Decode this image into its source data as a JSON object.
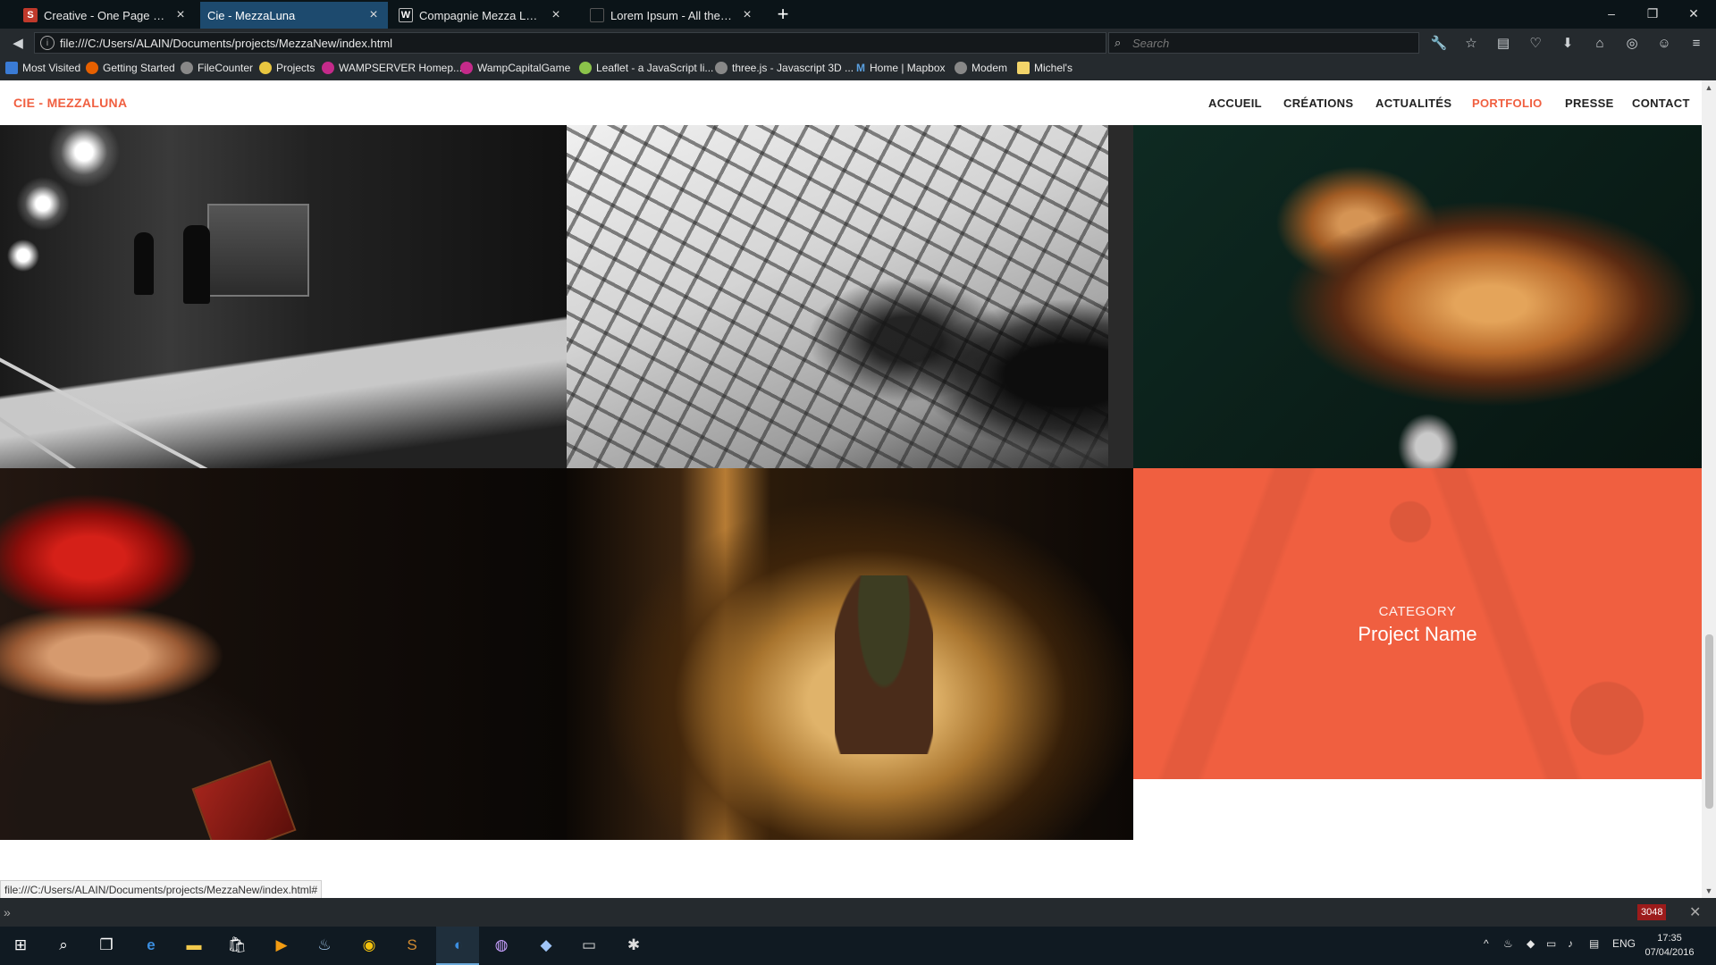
{
  "browser": {
    "tabs": [
      {
        "title": "Creative - One Page Boots...",
        "favicon": "S",
        "active": false
      },
      {
        "title": "Cie - MezzaLuna",
        "favicon": "",
        "active": true
      },
      {
        "title": "Compagnie Mezza Luna",
        "favicon": "W",
        "active": false
      },
      {
        "title": "Lorem Ipsum - All the fact...",
        "favicon": "",
        "active": false
      }
    ],
    "new_tab": "+",
    "url": "file:///C:/Users/ALAIN/Documents/projects/MezzaNew/index.html",
    "search_placeholder": "Search",
    "bookmarks": [
      {
        "label": "Most Visited"
      },
      {
        "label": "Getting Started"
      },
      {
        "label": "FileCounter"
      },
      {
        "label": "Projects"
      },
      {
        "label": "WAMPSERVER Homep..."
      },
      {
        "label": "WampCapitalGame"
      },
      {
        "label": "Leaflet - a JavaScript li..."
      },
      {
        "label": "three.js - Javascript 3D ..."
      },
      {
        "label": "Home | Mapbox"
      },
      {
        "label": "Modem"
      },
      {
        "label": "Michel's"
      }
    ],
    "status_url": "file:///C:/Users/ALAIN/Documents/projects/MezzaNew/index.html#",
    "dev_badge": "3048"
  },
  "site": {
    "brand": "CIE - MEZZALUNA",
    "menu": [
      "ACCUEIL",
      "CRÉATIONS",
      "ACTUALITÉS",
      "PORTFOLIO",
      "PRESSE",
      "CONTACT"
    ],
    "active_menu": "PORTFOLIO",
    "accent_color": "#f05f40",
    "portfolio_overlay": {
      "category": "CATEGORY",
      "project": "Project Name"
    }
  },
  "taskbar": {
    "language": "ENG",
    "time": "17:35",
    "date": "07/04/2016"
  }
}
